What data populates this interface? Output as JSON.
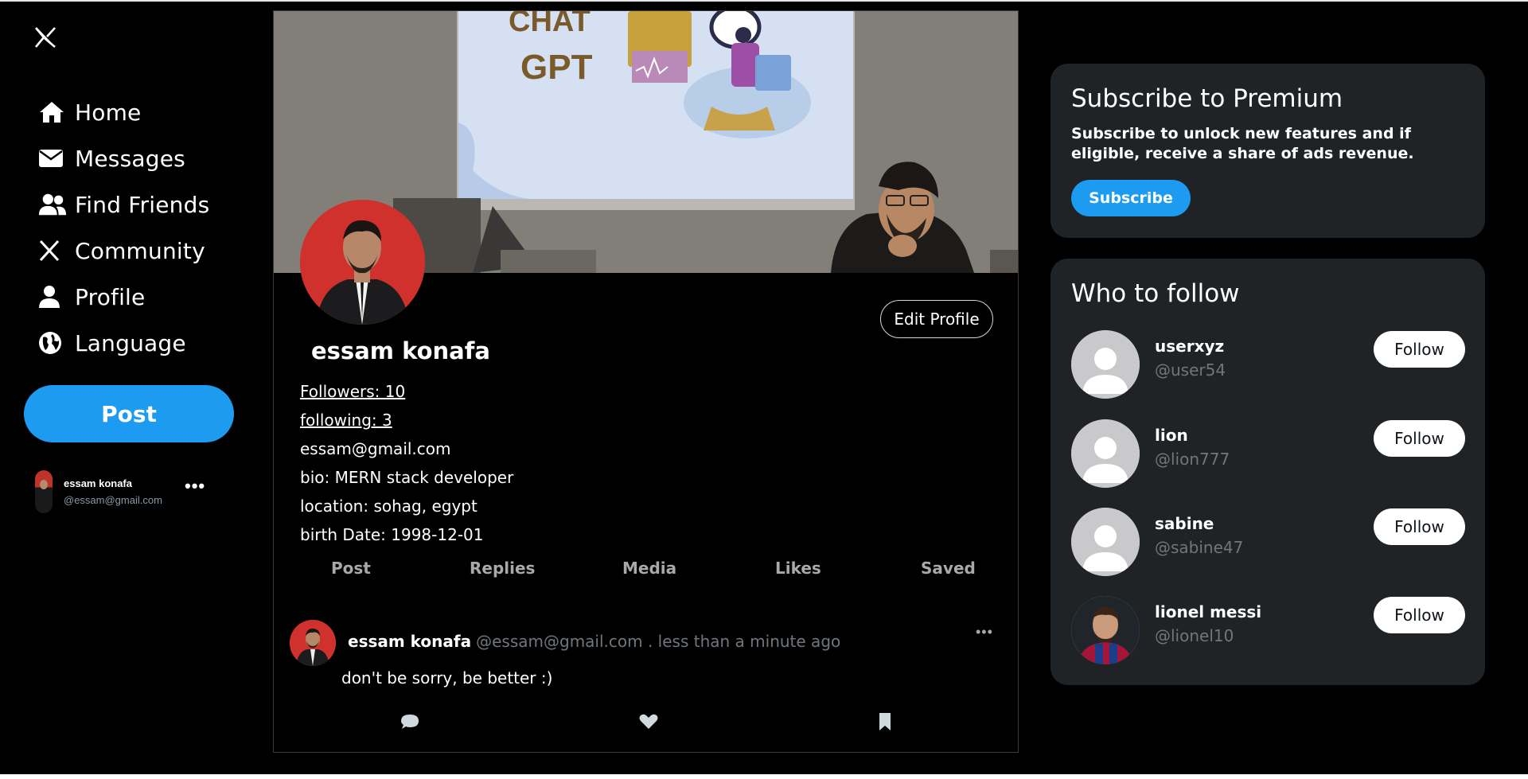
{
  "sidebar": {
    "logo": "x-logo-icon",
    "nav": [
      {
        "label": "Home",
        "icon": "home-icon"
      },
      {
        "label": "Messages",
        "icon": "envelope-icon"
      },
      {
        "label": "Find Friends",
        "icon": "users-icon"
      },
      {
        "label": "Community",
        "icon": "x-icon"
      },
      {
        "label": "Profile",
        "icon": "user-icon"
      },
      {
        "label": "Language",
        "icon": "globe-icon"
      }
    ],
    "post_label": "Post",
    "account": {
      "name": "essam konafa",
      "handle": "@essam@gmail.com",
      "more": "•••"
    }
  },
  "profile": {
    "name": "essam konafa",
    "edit_label": "Edit Profile",
    "followers": "Followers: 10",
    "following": "following: 3",
    "email": "essam@gmail.com",
    "bio": "bio: MERN stack developer",
    "location": "location: sohag, egypt",
    "birth": "birth Date: 1998-12-01",
    "cover_text": [
      "CHAT",
      "GPT"
    ]
  },
  "tabs": [
    "Post",
    "Replies",
    "Media",
    "Likes",
    "Saved"
  ],
  "post": {
    "author": "essam konafa",
    "meta": "@essam@gmail.com . less than a minute ago",
    "body": "don't be sorry, be better :)",
    "more": "•••"
  },
  "premium": {
    "title": "Subscribe to Premium",
    "text": "Subscribe to unlock new features and if eligible, receive a share of ads revenue.",
    "button": "Subscribe"
  },
  "who_to_follow": {
    "title": "Who to follow",
    "button": "Follow",
    "users": [
      {
        "name": "userxyz",
        "handle": "@user54"
      },
      {
        "name": "lion",
        "handle": "@lion777"
      },
      {
        "name": "sabine",
        "handle": "@sabine47"
      },
      {
        "name": "lionel messi",
        "handle": "@lionel10"
      }
    ]
  },
  "colors": {
    "accent": "#1d9bf0",
    "card": "#1f2326",
    "muted": "#71767b",
    "avatar_bg": "#d0312d"
  }
}
